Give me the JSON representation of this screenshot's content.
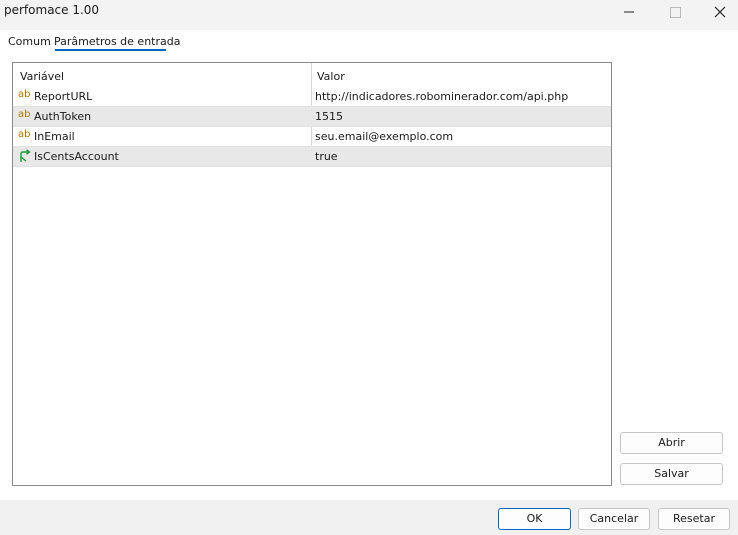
{
  "window": {
    "title": "perfomace 1.00",
    "minimize_icon": "minimize-icon",
    "maximize_icon": "maximize-icon",
    "close_icon": "close-icon"
  },
  "tabs": [
    {
      "label": "Comum",
      "active": false
    },
    {
      "label": "Parâmetros de entrada",
      "active": true
    }
  ],
  "grid": {
    "columns": [
      "Variável",
      "Valor"
    ],
    "rows": [
      {
        "icon": "text-type-icon",
        "icon_glyph": "ab",
        "name": "ReportURL",
        "value": "http://indicadores.robominerador.com/api.php"
      },
      {
        "icon": "text-type-icon",
        "icon_glyph": "ab",
        "name": "AuthToken",
        "value": "1515"
      },
      {
        "icon": "text-type-icon",
        "icon_glyph": "ab",
        "name": "InEmail",
        "value": "seu.email@exemplo.com"
      },
      {
        "icon": "bool-type-icon",
        "icon_glyph": "",
        "name": "IsCentsAccount",
        "value": "true"
      }
    ]
  },
  "side_buttons": {
    "open_label": "Abrir",
    "save_label": "Salvar"
  },
  "footer": {
    "ok_label": "OK",
    "cancel_label": "Cancelar",
    "reset_label": "Resetar"
  },
  "colors": {
    "accent": "#0067c0",
    "text_icon": "#b07800",
    "bool_icon": "#1a9a3c",
    "alt_row": "#e8e8e8"
  }
}
